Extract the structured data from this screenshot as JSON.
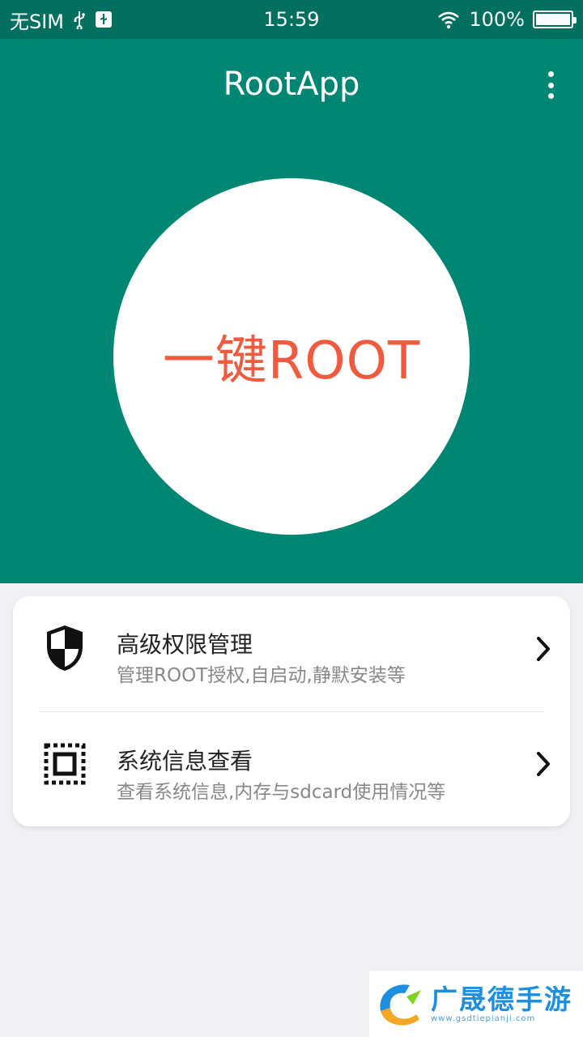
{
  "status_bar": {
    "carrier": "无SIM",
    "time": "15:59",
    "battery": "100%",
    "battery_level": 1.0
  },
  "app_bar": {
    "title": "RootApp",
    "menu_icon": "more-vert-icon"
  },
  "hero": {
    "button_label": "一键ROOT"
  },
  "list": {
    "items": [
      {
        "title": "高级权限管理",
        "subtitle": "管理ROOT授权,自启动,静默安装等",
        "icon": "shield-icon"
      },
      {
        "title": "系统信息查看",
        "subtitle": "查看系统信息,内存与sdcard使用情况等",
        "icon": "chip-icon"
      }
    ]
  },
  "watermark": {
    "text": "广晟德手游",
    "url": "www.gsdtiepianji.com"
  },
  "colors": {
    "primary": "#008673",
    "status_bar": "#03705f",
    "accent_text": "#f05a3f",
    "background": "#f0f0f5"
  }
}
